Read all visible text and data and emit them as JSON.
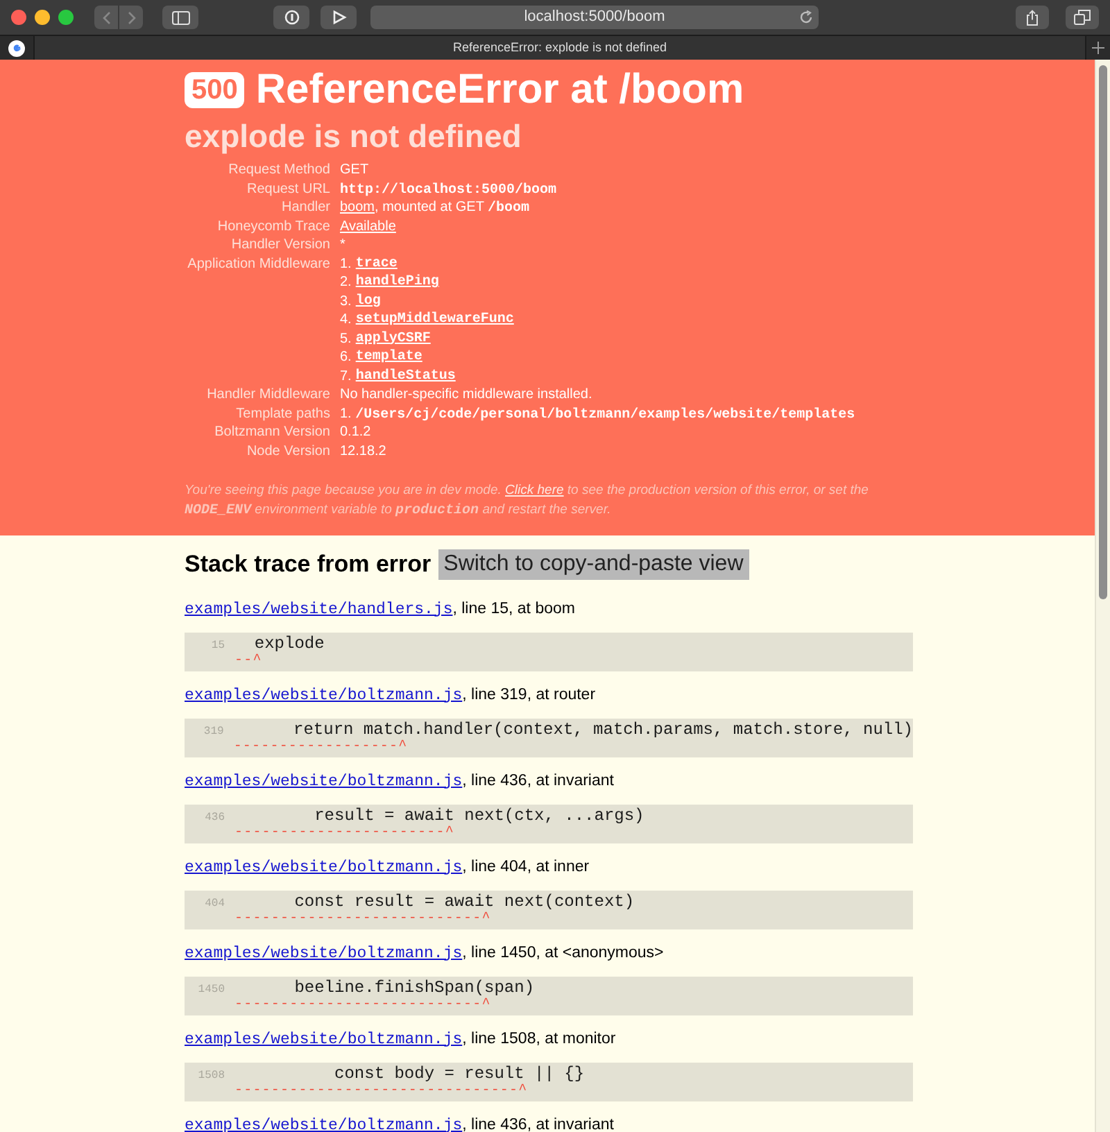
{
  "browser": {
    "address": "localhost:5000/boom",
    "tab_title": "ReferenceError: explode is not defined"
  },
  "header": {
    "status": "500",
    "title": "ReferenceError at /boom",
    "message": "explode is not defined",
    "details": [
      {
        "label": "Request Method",
        "kind": "segments",
        "segments": [
          {
            "kind": "text",
            "text": "GET"
          }
        ]
      },
      {
        "label": "Request URL",
        "kind": "segments",
        "segments": [
          {
            "kind": "code",
            "text": "http://localhost:5000/boom"
          }
        ]
      },
      {
        "label": "Handler",
        "kind": "segments",
        "segments": [
          {
            "kind": "link",
            "text": "boom"
          },
          {
            "kind": "text",
            "text": ", mounted at GET "
          },
          {
            "kind": "code",
            "text": "/boom"
          }
        ]
      },
      {
        "label": "Honeycomb Trace",
        "kind": "segments",
        "segments": [
          {
            "kind": "link",
            "text": "Available"
          }
        ]
      },
      {
        "label": "Handler Version",
        "kind": "segments",
        "segments": [
          {
            "kind": "text",
            "text": "*"
          }
        ]
      },
      {
        "label": "Application Middleware",
        "kind": "list",
        "items": [
          {
            "number": "1.",
            "name": "trace"
          },
          {
            "number": "2.",
            "name": "handlePing"
          },
          {
            "number": "3.",
            "name": "log"
          },
          {
            "number": "4.",
            "name": "setupMiddlewareFunc"
          },
          {
            "number": "5.",
            "name": "applyCSRF"
          },
          {
            "number": "6.",
            "name": "template"
          },
          {
            "number": "7.",
            "name": "handleStatus"
          }
        ]
      },
      {
        "label": "Handler Middleware",
        "kind": "segments",
        "segments": [
          {
            "kind": "text",
            "text": "No handler-specific middleware installed."
          }
        ]
      },
      {
        "label": "Template paths",
        "kind": "segments",
        "segments": [
          {
            "kind": "text",
            "text": "1. "
          },
          {
            "kind": "code",
            "text": "/Users/cj/code/personal/boltzmann/examples/website/templates"
          }
        ]
      },
      {
        "label": "Boltzmann Version",
        "kind": "segments",
        "segments": [
          {
            "kind": "text",
            "text": "0.1.2"
          }
        ]
      },
      {
        "label": "Node Version",
        "kind": "segments",
        "segments": [
          {
            "kind": "text",
            "text": "12.18.2"
          }
        ]
      }
    ],
    "note": [
      {
        "kind": "text",
        "text": "You're seeing this page because you are in dev mode. "
      },
      {
        "kind": "link",
        "text": "Click here"
      },
      {
        "kind": "text",
        "text": " to see the production version of this error, or set the "
      },
      {
        "kind": "code",
        "text": "NODE_ENV"
      },
      {
        "kind": "text",
        "text": " environment variable to "
      },
      {
        "kind": "code",
        "text": "production"
      },
      {
        "kind": "text",
        "text": " and restart the server."
      }
    ]
  },
  "stack": {
    "heading": "Stack trace from error",
    "toggle_button": "Switch to copy-and-paste view",
    "frames": [
      {
        "file": "examples/website/handlers.js",
        "location": ", line 15, at boom",
        "line_number": "15",
        "code": "  explode",
        "caret": "--^"
      },
      {
        "file": "examples/website/boltzmann.js",
        "location": ", line 319, at router",
        "line_number": "319",
        "code": "      return match.handler(context, match.params, match.store, null)",
        "caret": "------------------^"
      },
      {
        "file": "examples/website/boltzmann.js",
        "location": ", line 436, at invariant",
        "line_number": "436",
        "code": "        result = await next(ctx, ...args)",
        "caret": "-----------------------^"
      },
      {
        "file": "examples/website/boltzmann.js",
        "location": ", line 404, at inner",
        "line_number": "404",
        "code": "      const result = await next(context)",
        "caret": "---------------------------^"
      },
      {
        "file": "examples/website/boltzmann.js",
        "location": ", line 1450, at <anonymous>",
        "line_number": "1450",
        "code": "      beeline.finishSpan(span)",
        "caret": "---------------------------^"
      },
      {
        "file": "examples/website/boltzmann.js",
        "location": ", line 1508, at monitor",
        "line_number": "1508",
        "code": "          const body = result || {}",
        "caret": "-------------------------------^"
      },
      {
        "file": "examples/website/boltzmann.js",
        "location": ", line 436, at invariant"
      }
    ]
  }
}
